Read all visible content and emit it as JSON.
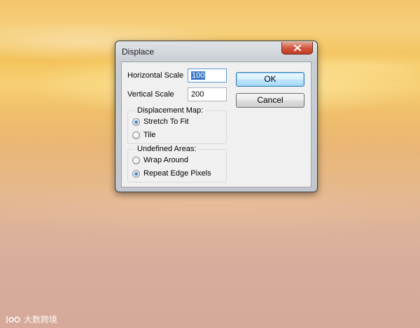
{
  "dialog": {
    "title": "Displace",
    "close_icon": "close-icon",
    "horizontal_scale": {
      "label": "Horizontal Scale",
      "value": "100"
    },
    "vertical_scale": {
      "label": "Vertical Scale",
      "value": "200"
    },
    "buttons": {
      "ok": "OK",
      "cancel": "Cancel"
    },
    "displacement_map": {
      "title": "Displacement Map:",
      "options": [
        {
          "label": "Stretch To Fit",
          "selected": true
        },
        {
          "label": "Tile",
          "selected": false
        }
      ]
    },
    "undefined_areas": {
      "title": "Undefined Areas:",
      "options": [
        {
          "label": "Wrap Around",
          "selected": false
        },
        {
          "label": "Repeat Edge Pixels",
          "selected": true
        }
      ]
    }
  },
  "watermark": {
    "logo": "logo-icon",
    "text": "大数跨境"
  },
  "colors": {
    "close_button": "#c23b22",
    "default_button_border": "#3c7fb1",
    "selection": "#3a75c4"
  }
}
